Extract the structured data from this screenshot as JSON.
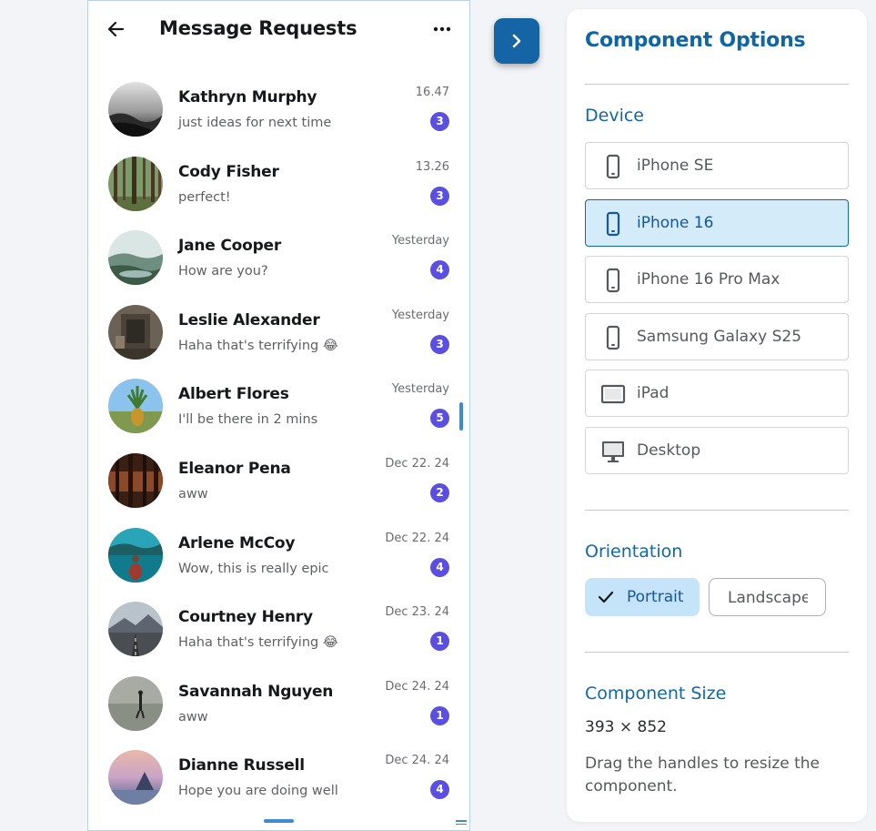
{
  "messages_screen": {
    "title": "Message Requests",
    "back_icon": "arrow-left-icon",
    "more_icon": "more-horizontal-icon",
    "conversations": [
      {
        "name": "Kathryn Murphy",
        "preview": "just ideas for next time",
        "time": "16.47",
        "unread": "3",
        "avatar": "misty-forest-photo"
      },
      {
        "name": "Cody Fisher",
        "preview": "perfect!",
        "time": "13.26",
        "unread": "3",
        "avatar": "pine-forest-photo"
      },
      {
        "name": "Jane Cooper",
        "preview": "How are you?",
        "time": "Yesterday",
        "unread": "4",
        "avatar": "mountain-lake-photo"
      },
      {
        "name": "Leslie Alexander",
        "preview": "Haha that's terrifying 😂",
        "time": "Yesterday",
        "unread": "3",
        "avatar": "old-building-photo"
      },
      {
        "name": "Albert Flores",
        "preview": "I'll be there in 2 mins",
        "time": "Yesterday",
        "unread": "5",
        "avatar": "pineapple-field-photo"
      },
      {
        "name": "Eleanor Pena",
        "preview": "aww",
        "time": "Dec 22. 24",
        "unread": "2",
        "avatar": "dark-woods-photo"
      },
      {
        "name": "Arlene McCoy",
        "preview": "Wow, this is really epic",
        "time": "Dec 22. 24",
        "unread": "4",
        "avatar": "kayak-lake-photo"
      },
      {
        "name": "Courtney Henry",
        "preview": "Haha that's terrifying 😂",
        "time": "Dec 23. 24",
        "unread": "1",
        "avatar": "mountain-road-photo"
      },
      {
        "name": "Savannah Nguyen",
        "preview": "aww",
        "time": "Dec 24. 24",
        "unread": "1",
        "avatar": "walking-person-photo"
      },
      {
        "name": "Dianne Russell",
        "preview": "Hope you are doing well",
        "time": "Dec 24. 24",
        "unread": "4",
        "avatar": "sunset-shore-photo"
      }
    ]
  },
  "panel_toggle": {
    "icon": "chevron-right-icon"
  },
  "options_panel": {
    "title": "Component Options",
    "device_label": "Device",
    "devices": [
      {
        "label": "iPhone SE",
        "icon": "phone-icon",
        "selected": false
      },
      {
        "label": "iPhone 16",
        "icon": "phone-icon",
        "selected": true
      },
      {
        "label": "iPhone 16 Pro Max",
        "icon": "phone-icon",
        "selected": false
      },
      {
        "label": "Samsung Galaxy S25",
        "icon": "phone-icon",
        "selected": false
      },
      {
        "label": "iPad",
        "icon": "tablet-icon",
        "selected": false
      },
      {
        "label": "Desktop",
        "icon": "desktop-icon",
        "selected": false
      }
    ],
    "orientation_label": "Orientation",
    "orientations": [
      {
        "label": "Portrait",
        "selected": true
      },
      {
        "label": "Landscape",
        "selected": false
      }
    ],
    "size_label": "Component Size",
    "size_value": "393 × 852",
    "size_help": "Drag the handles to resize the component."
  },
  "colors": {
    "accent": "#1267a7",
    "badge": "#5b4fe3",
    "selected_bg": "#d4ebfa",
    "toggle_bg": "#1565a6"
  }
}
